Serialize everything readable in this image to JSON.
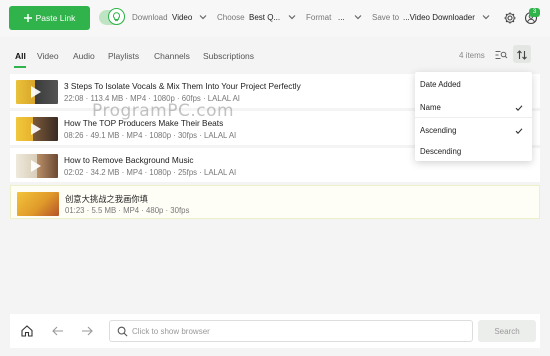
{
  "toolbar": {
    "paste_label": "Paste Link",
    "download_label": "Download",
    "download_value": "Video",
    "choose_label": "Choose",
    "choose_value": "Best Q...",
    "format_label": "Format",
    "format_value": "...",
    "save_label": "Save to",
    "save_value": "...Video Downloader",
    "notification_count": "3",
    "accent": "#2fb34a"
  },
  "tabs": [
    {
      "label": "All",
      "active": true
    },
    {
      "label": "Video"
    },
    {
      "label": "Audio"
    },
    {
      "label": "Playlists"
    },
    {
      "label": "Channels"
    },
    {
      "label": "Subscriptions"
    }
  ],
  "items_count": "4 items",
  "items": [
    {
      "title": "3 Steps To Isolate Vocals & Mix Them Into Your Project Perfectly",
      "meta": "22:08 · 113.4 MB · MP4 · 1080p · 60fps · LALAL AI"
    },
    {
      "title": "How The TOP Producers Make Their Beats",
      "meta": "08:26 · 49.1 MB · MP4 · 1080p · 30fps · LALAL AI"
    },
    {
      "title": "How to Remove Background Music",
      "meta": "02:02 · 34.2 MB · MP4 · 1080p · 25fps · LALAL AI"
    },
    {
      "title": "创意大挑战之我画你填",
      "meta": "01:23 · 5.5 MB · MP4 · 480p · 30fps"
    }
  ],
  "sort_menu": {
    "sort_by": [
      {
        "label": "Date Added",
        "checked": false
      },
      {
        "label": "Name",
        "checked": true
      }
    ],
    "order": [
      {
        "label": "Ascending",
        "checked": true
      },
      {
        "label": "Descending",
        "checked": false
      }
    ]
  },
  "watermark": "ProgramPC.com",
  "bottom": {
    "search_placeholder": "Click to show browser",
    "search_button": "Search"
  }
}
